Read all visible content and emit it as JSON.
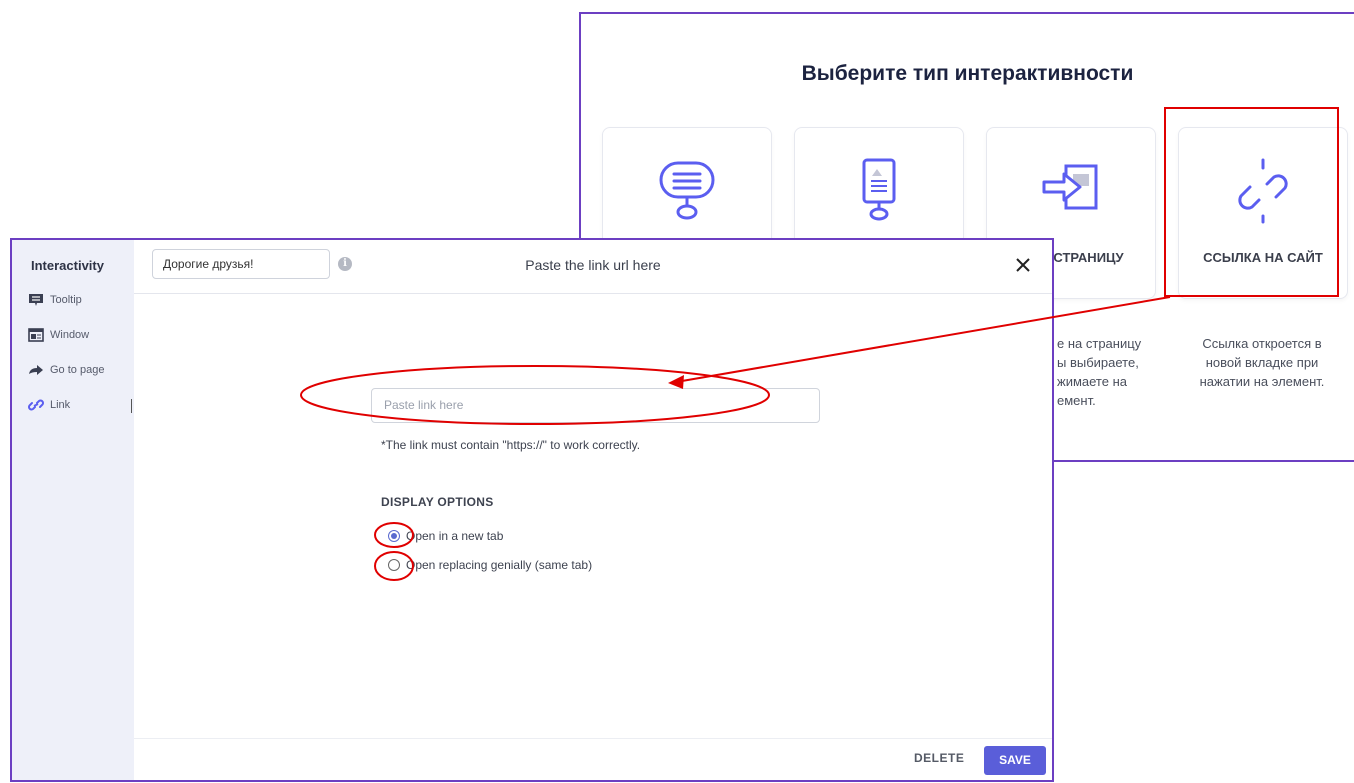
{
  "background_panel": {
    "title": "Выберите тип интерактивности",
    "cards": [
      {
        "icon": "tooltip-bubble-icon",
        "label": ""
      },
      {
        "icon": "window-card-icon",
        "label": ""
      },
      {
        "icon": "go-to-page-icon",
        "label": "НА СТРАНИЦУ"
      },
      {
        "icon": "link-chain-icon",
        "label": "ССЫЛКА НА САЙТ"
      }
    ],
    "descriptions": {
      "go_to_page": [
        "е на страницу",
        "ы выбираете,",
        "жимаете на",
        "емент."
      ],
      "link": [
        "Ссылка откроется в",
        "новой вкладке при",
        "нажатии на элемент."
      ]
    }
  },
  "dialog": {
    "sidebar": {
      "title": "Interactivity",
      "items": [
        {
          "label": "Tooltip",
          "icon": "tooltip-icon"
        },
        {
          "label": "Window",
          "icon": "window-icon"
        },
        {
          "label": "Go to page",
          "icon": "arrow-right-icon"
        },
        {
          "label": "Link",
          "icon": "link-icon",
          "active": true
        }
      ]
    },
    "header": {
      "name_value": "Дорогие друзья!",
      "info_icon": "i",
      "title": "Paste the link url here",
      "close_icon": "close-icon"
    },
    "link_input": {
      "placeholder": "Paste link here"
    },
    "hint": "*The link must contain \"https://\" to work correctly.",
    "display_options": {
      "title": "DISPLAY OPTIONS",
      "options": [
        {
          "label": "Open in a new tab",
          "selected": true
        },
        {
          "label": "Open replacing genially (same tab)",
          "selected": false
        }
      ]
    },
    "footer": {
      "delete_label": "DELETE",
      "save_label": "SAVE"
    }
  },
  "colors": {
    "accent": "#5a5ed9",
    "border_purple": "#6c3fc2",
    "annotation_red": "#e00000",
    "icon_blue": "#5b5ef0"
  }
}
